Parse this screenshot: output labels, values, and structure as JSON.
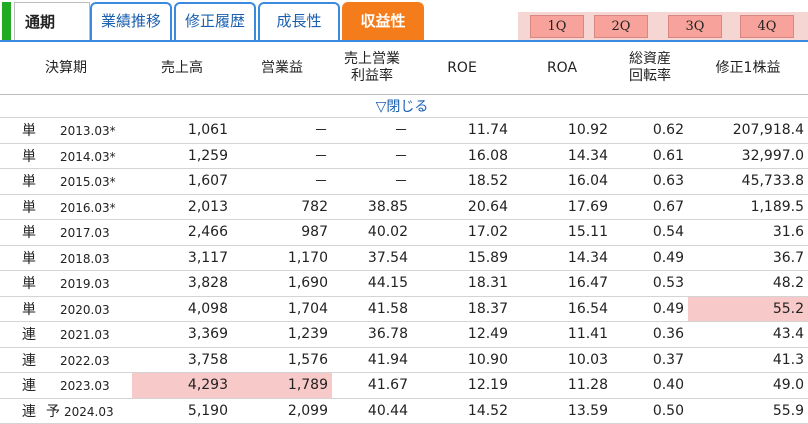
{
  "tabs": {
    "main": "通期",
    "items": [
      "業績推移",
      "修正履歴",
      "成長性",
      "収益性"
    ],
    "active": "収益性"
  },
  "quarters": [
    "1Q",
    "2Q",
    "3Q",
    "4Q"
  ],
  "columns": [
    "決算期",
    "売上高",
    "営業益",
    "売上営業\n利益率",
    "ROE",
    "ROA",
    "総資産\n回転率",
    "修正1株益"
  ],
  "toggle_label": "▽閉じる",
  "rows": [
    {
      "kind": "単",
      "period": "2013.03*",
      "sales": "1,061",
      "op": "－",
      "margin": "－",
      "roe": "11.74",
      "roa": "10.92",
      "turnover": "0.62",
      "eps": "207,918.4"
    },
    {
      "kind": "単",
      "period": "2014.03*",
      "sales": "1,259",
      "op": "－",
      "margin": "－",
      "roe": "16.08",
      "roa": "14.34",
      "turnover": "0.61",
      "eps": "32,997.0"
    },
    {
      "kind": "単",
      "period": "2015.03*",
      "sales": "1,607",
      "op": "－",
      "margin": "－",
      "roe": "18.52",
      "roa": "16.04",
      "turnover": "0.63",
      "eps": "45,733.8"
    },
    {
      "kind": "単",
      "period": "2016.03*",
      "sales": "2,013",
      "op": "782",
      "margin": "38.85",
      "roe": "20.64",
      "roa": "17.69",
      "turnover": "0.67",
      "eps": "1,189.5"
    },
    {
      "kind": "単",
      "period": "2017.03",
      "sales": "2,466",
      "op": "987",
      "margin": "40.02",
      "roe": "17.02",
      "roa": "15.11",
      "turnover": "0.54",
      "eps": "31.6"
    },
    {
      "kind": "単",
      "period": "2018.03",
      "sales": "3,117",
      "op": "1,170",
      "margin": "37.54",
      "roe": "15.89",
      "roa": "14.34",
      "turnover": "0.49",
      "eps": "36.7"
    },
    {
      "kind": "単",
      "period": "2019.03",
      "sales": "3,828",
      "op": "1,690",
      "margin": "44.15",
      "roe": "18.31",
      "roa": "16.47",
      "turnover": "0.53",
      "eps": "48.2"
    },
    {
      "kind": "単",
      "period": "2020.03",
      "sales": "4,098",
      "op": "1,704",
      "margin": "41.58",
      "roe": "18.37",
      "roa": "16.54",
      "turnover": "0.49",
      "eps": "55.2",
      "hl": [
        "eps"
      ]
    },
    {
      "kind": "連",
      "period": "2021.03",
      "sales": "3,369",
      "op": "1,239",
      "margin": "36.78",
      "roe": "12.49",
      "roa": "11.41",
      "turnover": "0.36",
      "eps": "43.4"
    },
    {
      "kind": "連",
      "period": "2022.03",
      "sales": "3,758",
      "op": "1,576",
      "margin": "41.94",
      "roe": "10.90",
      "roa": "10.03",
      "turnover": "0.37",
      "eps": "41.3"
    },
    {
      "kind": "連",
      "period": "2023.03",
      "sales": "4,293",
      "op": "1,789",
      "margin": "41.67",
      "roe": "12.19",
      "roa": "11.28",
      "turnover": "0.40",
      "eps": "49.0",
      "hl": [
        "sales",
        "op"
      ]
    },
    {
      "kind": "連",
      "forecast": "予",
      "period": "2024.03",
      "sales": "5,190",
      "op": "2,099",
      "margin": "40.44",
      "roe": "14.52",
      "roa": "13.59",
      "turnover": "0.50",
      "eps": "55.9"
    }
  ],
  "colors": {
    "accent": "#3a8ae0",
    "active_tab": "#f47c1a",
    "quarter_btn": "#f7a39b",
    "highlight": "#f8c9c9",
    "green_marker": "#22aa22"
  }
}
